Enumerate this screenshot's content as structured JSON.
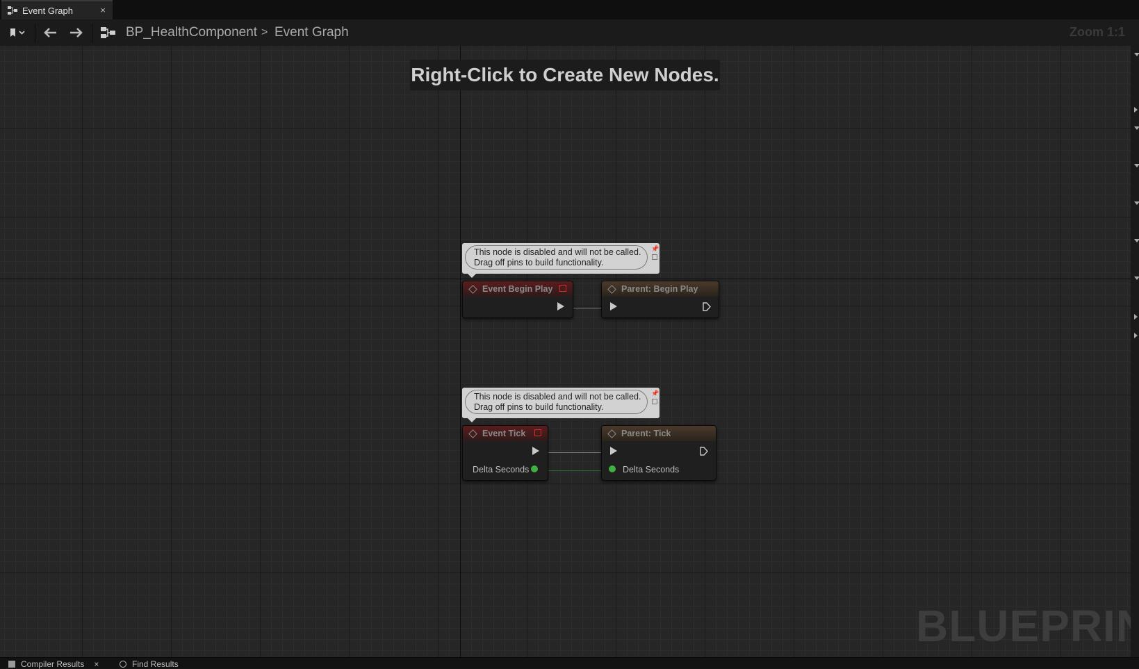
{
  "tab": {
    "label": "Event Graph",
    "close": "×"
  },
  "toolbar": {
    "breadcrumb_blueprint": "BP_HealthComponent",
    "breadcrumb_separator": ">",
    "breadcrumb_graph": "Event Graph",
    "zoom": "Zoom 1:1"
  },
  "graph": {
    "hint": "Right-Click to Create New Nodes.",
    "watermark": "BLUEPRINT"
  },
  "comments": [
    {
      "line1": "This node is disabled and will not be called.",
      "line2": "Drag off pins to build functionality."
    },
    {
      "line1": "This node is disabled and will not be called.",
      "line2": "Drag off pins to build functionality."
    }
  ],
  "nodes": {
    "begin_play": {
      "title": "Event Begin Play"
    },
    "parent_begin_play": {
      "title": "Parent: Begin Play"
    },
    "tick": {
      "title": "Event Tick",
      "pin": "Delta Seconds"
    },
    "parent_tick": {
      "title": "Parent: Tick",
      "pin": "Delta Seconds"
    }
  },
  "bottom_tabs": [
    {
      "label": "Compiler Results",
      "close": "×"
    },
    {
      "label": "Find Results"
    }
  ],
  "colors": {
    "event_header": "#5a1d1d",
    "parent_header": "#4a3a2a",
    "float_pin": "#3fb03f",
    "stop_icon": "#d03030"
  }
}
